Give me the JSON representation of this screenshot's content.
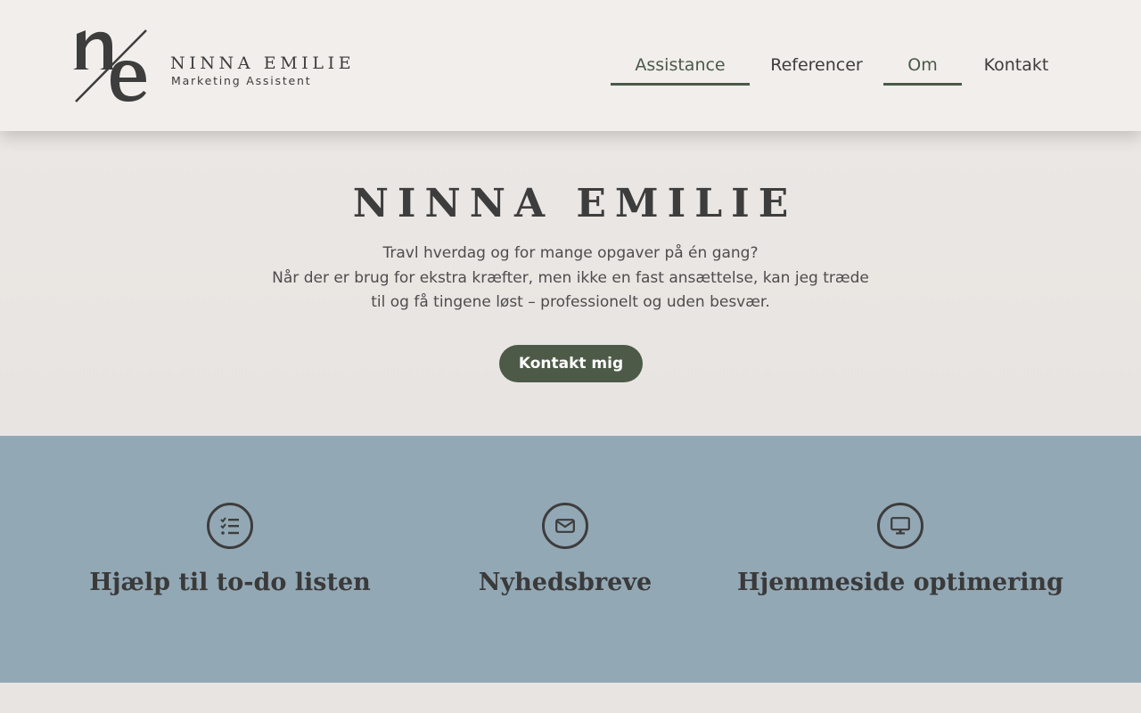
{
  "brand": {
    "name": "NINNA EMILIE",
    "tagline": "Marketing Assistent"
  },
  "nav": {
    "items": [
      {
        "label": "Assistance",
        "active": true
      },
      {
        "label": "Referencer",
        "active": false
      },
      {
        "label": "Om",
        "active": true
      },
      {
        "label": "Kontakt",
        "active": false
      }
    ]
  },
  "hero": {
    "title": "NINNA EMILIE",
    "lines": [
      "Travl hverdag og for mange opgaver på én gang?",
      "Når der er brug for ekstra kræfter, men ikke en fast ansættelse, kan jeg træde",
      "til og få tingene løst – professionelt og uden besvær."
    ],
    "cta_label": "Kontakt mig"
  },
  "services": [
    {
      "title": "Hjælp til to-do listen",
      "icon": "checklist-icon"
    },
    {
      "title": "Nyhedsbreve",
      "icon": "envelope-icon"
    },
    {
      "title": "Hjemmeside optimering",
      "icon": "monitor-icon"
    }
  ],
  "colors": {
    "header_bg": "#f1eeeb",
    "hero_bg": "#e8e4e1",
    "accent": "#4d5a48",
    "services_bg": "#93a8b5",
    "text": "#3d3d3d"
  }
}
